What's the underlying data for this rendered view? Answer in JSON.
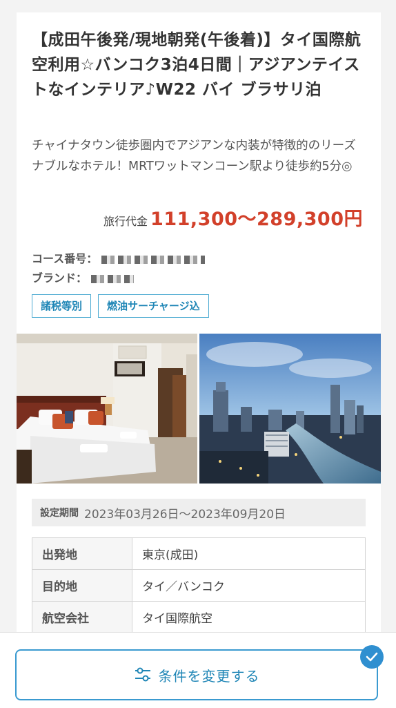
{
  "tour": {
    "title": "【成田午後発/現地朝発(午後着)】タイ国際航空利用☆バンコク3泊4日間｜アジアンテイストなインテリア♪W22 バイ ブラサリ泊",
    "description": "チャイナタウン徒歩圏内でアジアンな内装が特徴的のリーズナブルなホテル！MRTワットマンコーン駅より徒歩約5分◎",
    "price_label": "旅行代金",
    "price_value": "111,300〜289,300円",
    "course_label": "コース番号：",
    "brand_label": "ブランド：",
    "tags": [
      "諸税等別",
      "燃油サーチャージ込"
    ],
    "period_label": "設定期間",
    "period_value": "2023年03月26日〜2023年09月20日",
    "info_rows": [
      {
        "key": "出発地",
        "value": "東京(成田)"
      },
      {
        "key": "目的地",
        "value": "タイ／バンコク"
      },
      {
        "key": "航空会社",
        "value": "タイ国際航空"
      }
    ]
  },
  "bottom": {
    "change_label": "条件を変更する",
    "button_icon": "sliders-icon",
    "badge_icon": "check-icon"
  },
  "colors": {
    "accent": "#2f8fd0",
    "price": "#d2402a",
    "tag_border": "#49a9d1"
  }
}
